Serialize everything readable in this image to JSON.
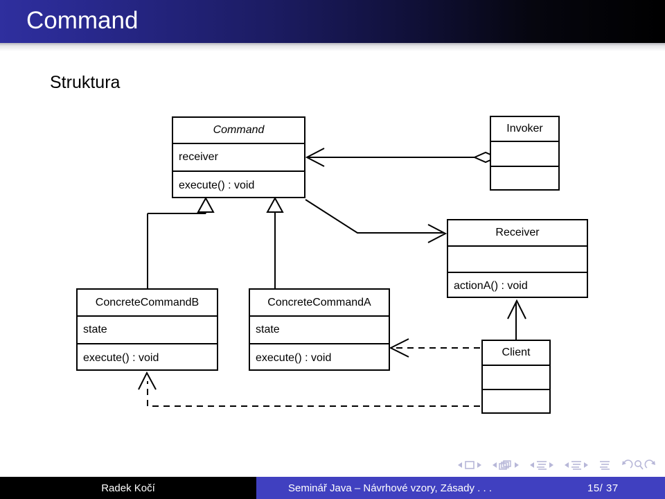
{
  "header": {
    "title": "Command"
  },
  "slide": {
    "heading": "Struktura"
  },
  "diagram": {
    "type": "uml-class-diagram",
    "pattern": "Command",
    "classes": [
      {
        "id": "command",
        "name": "Command",
        "abstract": true,
        "attributes": [
          "receiver"
        ],
        "operations": [
          "execute() : void"
        ]
      },
      {
        "id": "invoker",
        "name": "Invoker",
        "abstract": false,
        "attributes": [
          ""
        ],
        "operations": [
          ""
        ]
      },
      {
        "id": "receiver",
        "name": "Receiver",
        "abstract": false,
        "attributes": [
          ""
        ],
        "operations": [
          "actionA() : void"
        ]
      },
      {
        "id": "concrete-command-b",
        "name": "ConcreteCommandB",
        "abstract": false,
        "attributes": [
          "state"
        ],
        "operations": [
          "execute() : void"
        ]
      },
      {
        "id": "concrete-command-a",
        "name": "ConcreteCommandA",
        "abstract": false,
        "attributes": [
          "state"
        ],
        "operations": [
          "execute() : void"
        ]
      },
      {
        "id": "client",
        "name": "Client",
        "abstract": false,
        "attributes": [
          ""
        ],
        "operations": [
          ""
        ]
      }
    ],
    "relations": [
      {
        "kind": "aggregation",
        "from": "invoker",
        "to": "command"
      },
      {
        "kind": "generalization",
        "from": "concrete-command-b",
        "to": "command"
      },
      {
        "kind": "generalization",
        "from": "concrete-command-a",
        "to": "command"
      },
      {
        "kind": "association",
        "from": "command",
        "to": "receiver"
      },
      {
        "kind": "dependency",
        "from": "client",
        "to": "concrete-command-a"
      },
      {
        "kind": "dependency",
        "from": "client",
        "to": "concrete-command-b"
      },
      {
        "kind": "association",
        "from": "client",
        "to": "receiver"
      }
    ]
  },
  "nav": {
    "icons": [
      "prev-frame-icon",
      "frame-icon",
      "next-frame-icon",
      "prev-subsection-icon",
      "slides-stack-icon",
      "next-subsection-icon",
      "prev-section-icon",
      "section-list-icon",
      "next-section-icon",
      "prev-part-icon",
      "part-list-icon",
      "next-part-icon",
      "toc-icon",
      "back-icon",
      "search-icon",
      "forward-icon"
    ]
  },
  "footer": {
    "author": "Radek Kočí",
    "subject": "Seminář Java – Návrhové vzory, Zásady . . .",
    "page": "15/ 37"
  },
  "colors": {
    "header_start": "#2f2f9e",
    "header_end": "#000000",
    "footer_bar": "#4040c0",
    "footer_author_bg": "#000000",
    "nav_icon": "#b7b7d8",
    "diagram_stroke": "#000000"
  }
}
